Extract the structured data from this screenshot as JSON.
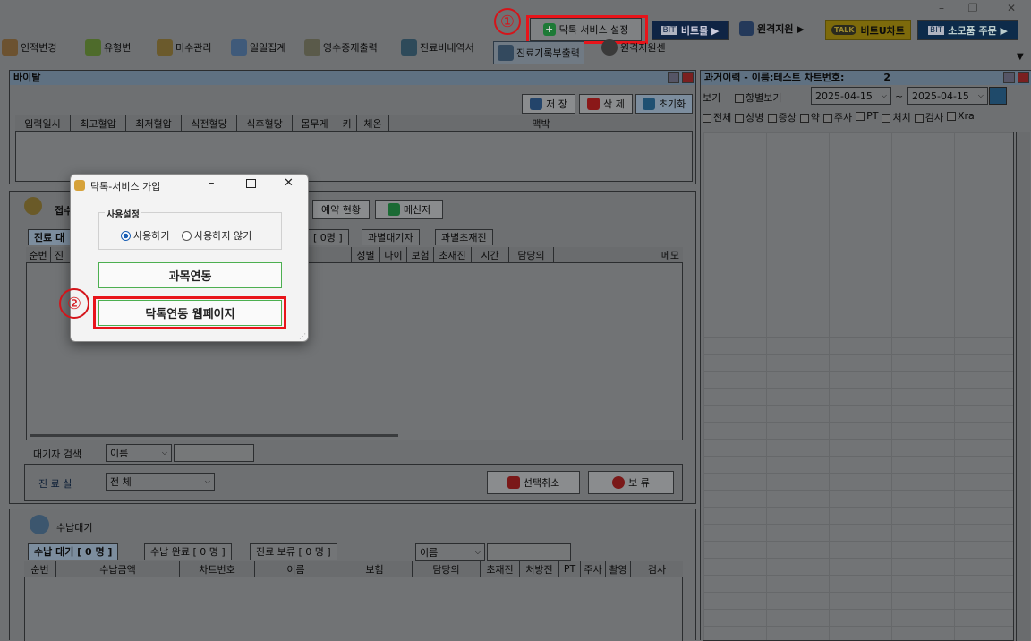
{
  "window": {
    "min": "–",
    "restore": "❐",
    "close": "✕"
  },
  "topbar": {
    "service_settings": "닥톡 서비스 설정",
    "bitmall": "비트몰 ▶",
    "remote_support": "원격지원 ▶",
    "talk_badge": "TALK",
    "bitu_chart": "비트U차트",
    "shop_order": "소모품 주문 ▶",
    "bit_logo": "BIT"
  },
  "toolbar": [
    "인적변경",
    "유형변",
    "미수관리",
    "일일집계",
    "영수증재출력",
    "진료비내역서",
    "진료기록부출력",
    "원격지원센"
  ],
  "vital": {
    "title": "바이탈",
    "save": "저 장",
    "delete": "삭 제",
    "reset": "초기화",
    "columns": [
      "입력일시",
      "최고혈압",
      "최저혈압",
      "식전혈당",
      "식후혈당",
      "몸무게",
      "키",
      "체온",
      "맥박"
    ]
  },
  "reception": {
    "label": "접수",
    "reservation_status": "예약 현황",
    "messenger": "메신저",
    "tabs": [
      "진료 대",
      "[ 0명 ]",
      "과별대기자",
      "과별초재진"
    ],
    "columns": [
      "순번",
      "진",
      "성별",
      "나이",
      "보험",
      "초재진",
      "시간",
      "담당의",
      "메모"
    ],
    "search_label": "대기자 검색",
    "search_select": "이름",
    "room_label": "진 료 실",
    "room_select": "전 체",
    "cancel_selection": "선택취소",
    "hold": "보  류"
  },
  "payment": {
    "title": "수납대기",
    "tabs": [
      "수납 대기 [ 0 명 ]",
      "수납 완료 [ 0 명 ]",
      "진료 보류 [ 0 명 ]"
    ],
    "search_select": "이름",
    "columns": [
      "순번",
      "수납금액",
      "차트번호",
      "이름",
      "보험",
      "담당의",
      "초재진",
      "처방전",
      "PT",
      "주사",
      "촬영",
      "검사"
    ]
  },
  "history": {
    "title": "과거이력 - 이름:테스트 차트번호:",
    "chart_no": "2",
    "view_label": "보기",
    "per_item": "항별보기",
    "date_from": "2025-04-15",
    "date_to": "2025-04-15",
    "tilde": "~",
    "filters": [
      "전체",
      "상병",
      "증상",
      "약",
      "주사",
      "PT",
      "처치",
      "검사",
      "Xra"
    ]
  },
  "dialog": {
    "title": "닥톡-서비스 가입",
    "group": "사용설정",
    "use": "사용하기",
    "not_use": "사용하지 않기",
    "subject_link": "과목연동",
    "web_link": "닥톡연동 웹페이지"
  },
  "annotations": {
    "one": "①",
    "two": "②"
  }
}
